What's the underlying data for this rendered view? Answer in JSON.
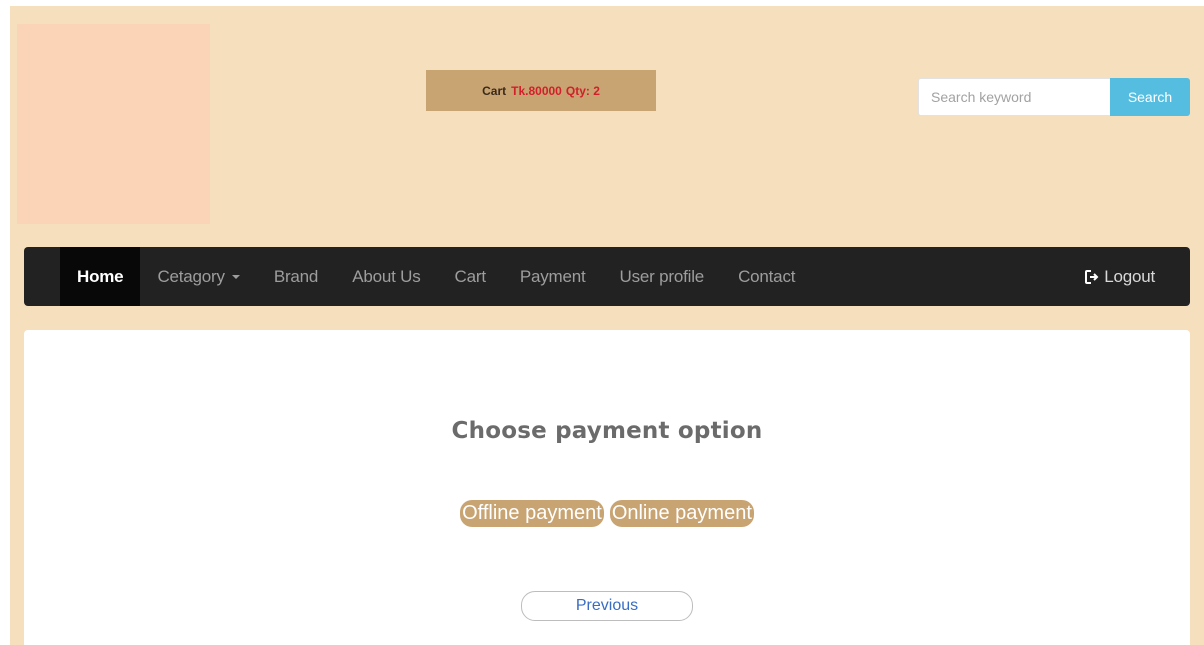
{
  "header": {
    "cart": {
      "label": "Cart",
      "amount": "Tk.80000",
      "qty": "Qty: 2"
    },
    "search": {
      "placeholder": "Search keyword",
      "button_label": "Search"
    }
  },
  "nav": {
    "items": [
      {
        "label": "Home",
        "active": true
      },
      {
        "label": "Cetagory",
        "dropdown": true
      },
      {
        "label": "Brand"
      },
      {
        "label": "About Us"
      },
      {
        "label": "Cart"
      },
      {
        "label": "Payment"
      },
      {
        "label": "User profile"
      },
      {
        "label": "Contact"
      }
    ],
    "logout_label": "Logout"
  },
  "main": {
    "title": "Choose payment option",
    "offline_label": "Offline payment",
    "online_label": "Online payment",
    "previous_label": "Previous"
  },
  "colors": {
    "page_bg": "#f5dfbd",
    "cart_bg": "#c9a473",
    "cart_highlight": "#d0202a",
    "search_button": "#55bde0",
    "navbar_bg": "#222222",
    "navbar_active_bg": "#080808",
    "logo_placeholder": "#fbd3b6"
  }
}
